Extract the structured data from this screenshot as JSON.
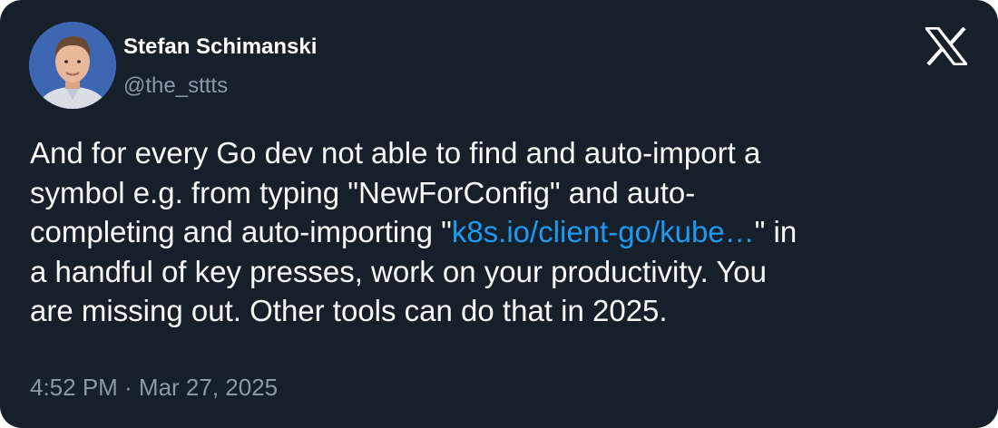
{
  "author": {
    "name": "Stefan Schimanski",
    "handle": "@the_sttts"
  },
  "platform_icon": "x-logo-icon",
  "tweet": {
    "line1": "And for every Go dev not able to find and auto-import a",
    "line2": "symbol e.g. from typing \"NewForConfig\" and auto-",
    "line3_before": "completing and auto-importing \"",
    "line3_link": "k8s.io/client-go/kube…",
    "line3_after": "\" in",
    "line4": "a handful of key presses, work on your productivity. You",
    "line5": "are missing out. Other tools can do that in 2025."
  },
  "timestamp": "4:52 PM · Mar 27, 2025",
  "colors": {
    "background": "#16202b",
    "text": "#f7f9f9",
    "secondary": "#8b98a5",
    "link": "#1d9bf0"
  }
}
